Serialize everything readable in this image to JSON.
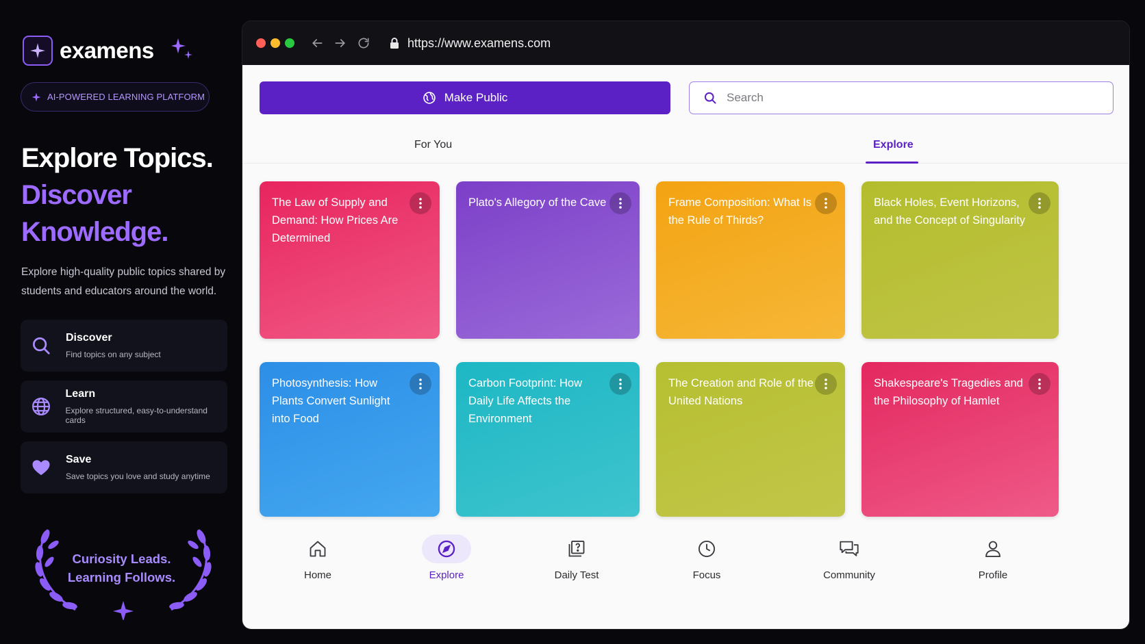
{
  "brand": {
    "name": "examens",
    "tagline": "AI-POWERED LEARNING PLATFORM"
  },
  "hero": {
    "line1": "Explore Topics.",
    "line2": "Discover Knowledge.",
    "description": "Explore high-quality public topics shared by students and educators around the world."
  },
  "features": [
    {
      "title": "Discover",
      "subtitle": "Find topics on any subject",
      "icon": "search-icon"
    },
    {
      "title": "Learn",
      "subtitle": "Explore structured, easy-to-understand cards",
      "icon": "globe-icon"
    },
    {
      "title": "Save",
      "subtitle": "Save topics you love and study anytime",
      "icon": "heart-icon"
    }
  ],
  "quote": "Curiosity Leads. Learning Follows.",
  "browser": {
    "url": "https://www.examens.com"
  },
  "toolbar": {
    "make_public_label": "Make Public",
    "search_placeholder": "Search"
  },
  "tabs": [
    {
      "label": "For You",
      "active": false
    },
    {
      "label": "Explore",
      "active": true
    }
  ],
  "cards": [
    {
      "title": "The Law of Supply and Demand: How Prices Are Determined",
      "color_from": "#e8245e",
      "color_to": "#f05a86"
    },
    {
      "title": "Plato's Allegory of the Cave",
      "color_from": "#7c3fc8",
      "color_to": "#9b6bd9"
    },
    {
      "title": "Frame Composition: What Is the Rule of Thirds?",
      "color_from": "#f3a312",
      "color_to": "#f6b737"
    },
    {
      "title": "Black Holes, Event Horizons, and the Concept of Singularity",
      "color_from": "#b3bd2c",
      "color_to": "#c0c446"
    },
    {
      "title": "Photosynthesis: How Plants Convert Sunlight into Food",
      "color_from": "#2c8ee6",
      "color_to": "#45a8f0"
    },
    {
      "title": "Carbon Footprint: How Daily Life Affects the Environment",
      "color_from": "#1db7c4",
      "color_to": "#3ec4ce"
    },
    {
      "title": "The Creation and Role of the United Nations",
      "color_from": "#b6bf30",
      "color_to": "#c2c649"
    },
    {
      "title": "Shakespeare's Tragedies and the Philosophy of Hamlet",
      "color_from": "#e3285f",
      "color_to": "#ef5a88"
    }
  ],
  "bottom_nav": [
    {
      "label": "Home",
      "icon": "home-icon",
      "active": false
    },
    {
      "label": "Explore",
      "icon": "compass-icon",
      "active": true
    },
    {
      "label": "Daily Test",
      "icon": "quiz-icon",
      "active": false
    },
    {
      "label": "Focus",
      "icon": "clock-icon",
      "active": false
    },
    {
      "label": "Community",
      "icon": "chat-icon",
      "active": false
    },
    {
      "label": "Profile",
      "icon": "user-icon",
      "active": false
    }
  ],
  "colors": {
    "accent": "#5b21c4",
    "accent_light": "#9d6bff",
    "background": "#07070c"
  }
}
